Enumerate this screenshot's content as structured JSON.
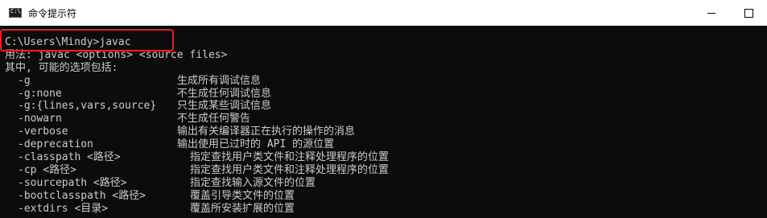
{
  "window": {
    "title": "命令提示符",
    "icon": "cmd-icon",
    "controls": [
      "minimize",
      "maximize"
    ]
  },
  "console": {
    "prompt_line": "C:\\Users\\Mindy>javac",
    "usage_line": "用法: javac <options> <source files>",
    "options_header": "其中, 可能的选项包括:",
    "options": [
      {
        "opt": "-g",
        "desc": "生成所有调试信息"
      },
      {
        "opt": "-g:none",
        "desc": "不生成任何调试信息"
      },
      {
        "opt": "-g:{lines,vars,source}",
        "desc": "只生成某些调试信息"
      },
      {
        "opt": "-nowarn",
        "desc": "不生成任何警告"
      },
      {
        "opt": "-verbose",
        "desc": "输出有关编译器正在执行的操作的消息"
      },
      {
        "opt": "-deprecation",
        "desc": "输出使用已过时的 API 的源位置"
      },
      {
        "opt": "-classpath <路径>",
        "desc": "指定查找用户类文件和注释处理程序的位置"
      },
      {
        "opt": "-cp <路径>",
        "desc": "指定查找用户类文件和注释处理程序的位置"
      },
      {
        "opt": "-sourcepath <路径>",
        "desc": "指定查找输入源文件的位置"
      },
      {
        "opt": "-bootclasspath <路径>",
        "desc": "覆盖引导类文件的位置"
      },
      {
        "opt": "-extdirs <目录>",
        "desc": "覆盖所安装扩展的位置"
      }
    ]
  },
  "colors": {
    "titlebar": "#ffffff",
    "console_bg": "#0c0c0c",
    "console_text": "#cccccc",
    "highlight": "#e8231f"
  }
}
